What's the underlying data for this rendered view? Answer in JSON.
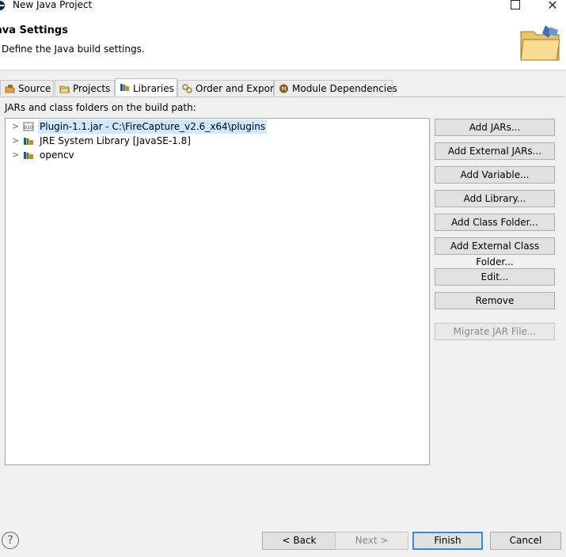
{
  "window": {
    "title": "New Java Project"
  },
  "banner": {
    "title": "ava Settings",
    "description": "Define the Java build settings."
  },
  "tabs": [
    {
      "label": "Source",
      "icon": "source-icon"
    },
    {
      "label": "Projects",
      "icon": "projects-icon"
    },
    {
      "label": "Libraries",
      "icon": "libraries-icon",
      "active": true
    },
    {
      "label": "Order and Export",
      "icon": "order-export-icon"
    },
    {
      "label": "Module Dependencies",
      "icon": "module-icon"
    }
  ],
  "libraries": {
    "path_label": "JARs and class folders on the build path:",
    "items": [
      {
        "label": "Plugin-1.1.jar - C:\\FireCapture_v2.6_x64\\plugins",
        "icon": "jar-icon",
        "selected": true
      },
      {
        "label": "JRE System Library [JavaSE-1.8]",
        "icon": "library-icon"
      },
      {
        "label": "opencv",
        "icon": "library-icon"
      }
    ],
    "buttons": {
      "add_jars": "Add JARs...",
      "add_external_jars": "Add External JARs...",
      "add_variable": "Add Variable...",
      "add_library": "Add Library...",
      "add_class_folder": "Add Class Folder...",
      "add_external_class_folder": "Add External Class Folder...",
      "edit": "Edit...",
      "remove": "Remove",
      "migrate_jar": "Migrate JAR File..."
    }
  },
  "footer": {
    "help": "?",
    "back": "< Back",
    "next": "Next >",
    "finish": "Finish",
    "cancel": "Cancel"
  },
  "colors": {
    "selection": "#cde8ff",
    "default_button_border": "#3a8ad6"
  }
}
